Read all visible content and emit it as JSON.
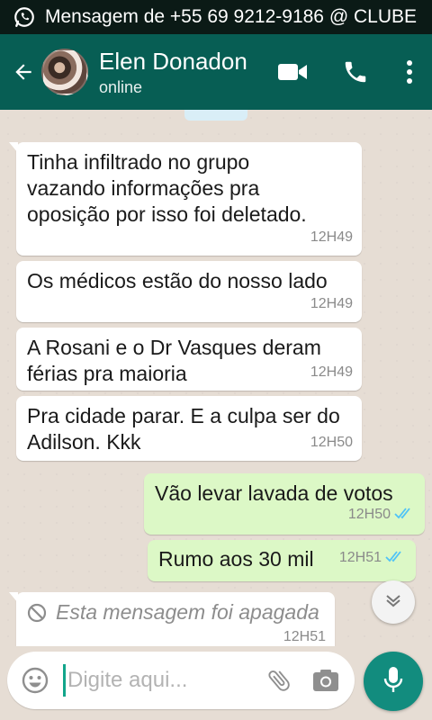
{
  "statusbar": {
    "notification": "Mensagem de +55 69 9212-9186 @ CLUBE"
  },
  "header": {
    "contact_name": "Elen Donadon",
    "status": "online"
  },
  "messages": [
    {
      "direction": "in",
      "text": "Tinha infiltrado no grupo vazando informações pra oposição por isso foi deletado.",
      "time": "12H49"
    },
    {
      "direction": "in",
      "text": "Os médicos estão do nosso lado",
      "time": "12H49"
    },
    {
      "direction": "in",
      "text": "A Rosani e o Dr Vasques deram férias pra maioria",
      "time": "12H49"
    },
    {
      "direction": "in",
      "text": "Pra cidade parar. E a culpa ser do Adilson. Kkk",
      "time": "12H50"
    },
    {
      "direction": "out",
      "text": "Vão levar lavada de votos",
      "time": "12H50",
      "status": "read"
    },
    {
      "direction": "out",
      "text": "Rumo aos 30 mil",
      "time": "12H51",
      "status": "read"
    },
    {
      "direction": "in",
      "text": "Esta mensagem foi apagada",
      "time": "12H51",
      "deleted": true
    }
  ],
  "composer": {
    "placeholder": "Digite aqui..."
  },
  "icons": {
    "whatsapp": "whatsapp-icon",
    "back": "back-arrow-icon",
    "video": "video-call-icon",
    "call": "phone-icon",
    "menu": "more-vert-icon",
    "emoji": "emoji-icon",
    "attach": "paperclip-icon",
    "camera": "camera-icon",
    "mic": "mic-icon",
    "scroll": "chevron-down-icon",
    "read": "double-check-icon",
    "deleted": "ban-icon"
  },
  "colors": {
    "header": "#075e54",
    "outgoing_bubble": "#dcf8c6",
    "incoming_bubble": "#ffffff",
    "read_ticks": "#4fc3f7",
    "mic_button": "#128c7e"
  }
}
